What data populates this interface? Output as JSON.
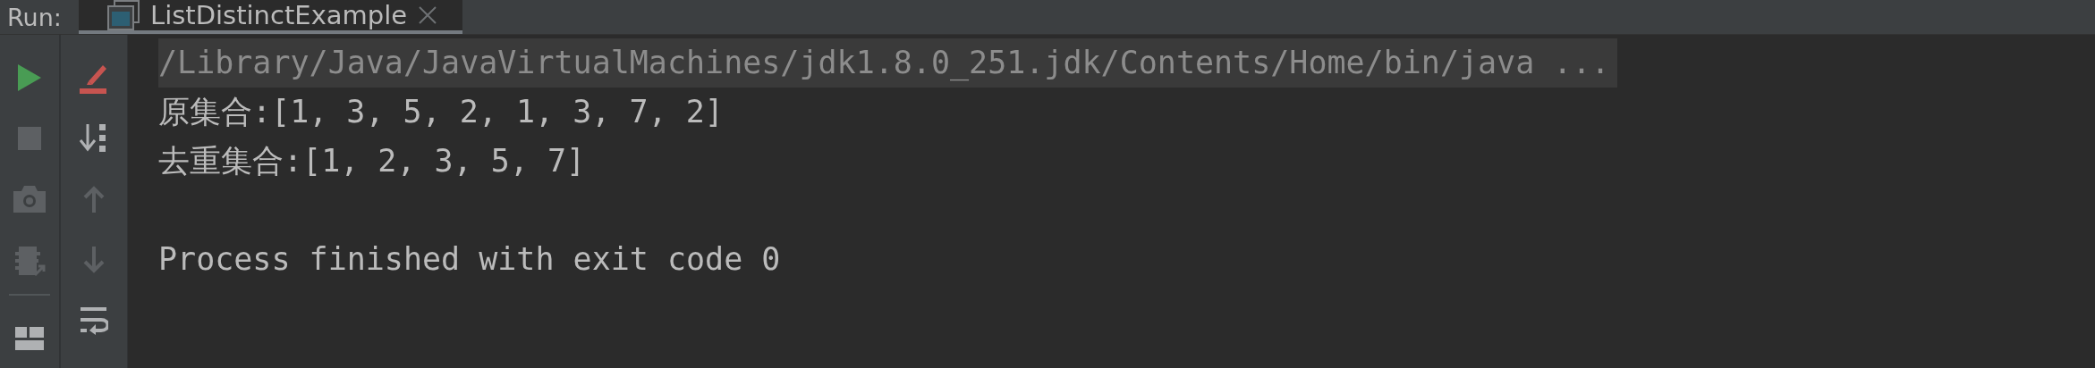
{
  "run_label": "Run:",
  "tabs": [
    {
      "title": "ListDistinctExample",
      "selected": true
    }
  ],
  "left_toolbar": [
    {
      "kind": "run",
      "disabled": false
    },
    {
      "kind": "stop",
      "disabled": true
    },
    {
      "kind": "camera",
      "disabled": true
    },
    {
      "kind": "debug",
      "disabled": true
    },
    {
      "kind": "divider"
    },
    {
      "kind": "layout",
      "disabled": false
    }
  ],
  "right_toolbar": [
    {
      "kind": "clear",
      "disabled": false
    },
    {
      "kind": "sort",
      "disabled": false
    },
    {
      "kind": "up",
      "disabled": true
    },
    {
      "kind": "down",
      "disabled": true
    },
    {
      "kind": "wrap",
      "disabled": false
    }
  ],
  "console": [
    {
      "kind": "command",
      "text": "/Library/Java/JavaVirtualMachines/jdk1.8.0_251.jdk/Contents/Home/bin/java ..."
    },
    {
      "kind": "stdout",
      "text": "原集合:[1, 3, 5, 2, 1, 3, 7, 2]"
    },
    {
      "kind": "stdout",
      "text": "去重集合:[1, 2, 3, 5, 7]"
    },
    {
      "kind": "system",
      "text": "Process finished with exit code 0"
    }
  ]
}
